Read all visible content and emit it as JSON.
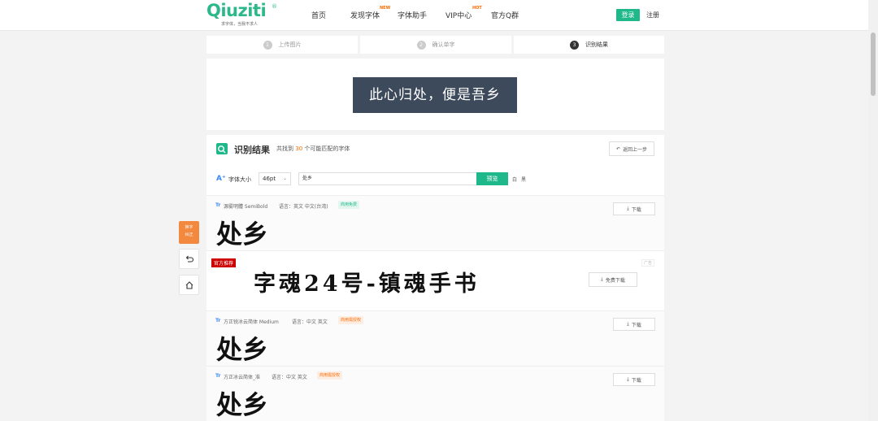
{
  "header": {
    "logo": "Qiuziti",
    "logo_reg": "®",
    "slogan": "求字体，当我不求人",
    "nav": [
      {
        "label": "首页",
        "badge": ""
      },
      {
        "label": "发现字体",
        "badge": "NEW"
      },
      {
        "label": "字体助手",
        "badge": ""
      },
      {
        "label": "VIP中心",
        "badge": "HOT"
      },
      {
        "label": "官方Q群",
        "badge": ""
      }
    ],
    "login": "登录",
    "register": "注册"
  },
  "steps": [
    {
      "num": "1",
      "label": "上传图片"
    },
    {
      "num": "2",
      "label": "确认单字"
    },
    {
      "num": "3",
      "label": "识别结果"
    }
  ],
  "preview_image_text": "此心归处，便是吾乡",
  "results": {
    "title": "识别结果",
    "count_prefix": "共找到",
    "count": "30",
    "count_suffix": "个可能匹配的字体",
    "back": "返回上一步",
    "font_size_label": "字体大小",
    "font_size_value": "46pt",
    "preview_text": "处乡",
    "preview_button": "预览",
    "bg_options": [
      "白",
      "黑"
    ]
  },
  "fonts": [
    {
      "name": "源雾明體 SemiBold",
      "lang": "语言：英文 中文(台湾)",
      "tag": "商用免费",
      "download": "下载",
      "sample": "处乡"
    },
    {
      "name": "方正锐冰云简体 Medium",
      "lang": "语言：中文 英文",
      "tag": "商用需授权",
      "download": "下载",
      "sample": "处乡"
    },
    {
      "name": "方正冰云简体_准",
      "lang": "语言：中文 英文",
      "tag": "商用需授权",
      "download": "下载",
      "sample": "处乡"
    }
  ],
  "ad": {
    "badge": "官方推荐",
    "art_text": "字魂24号-镇魂手书",
    "download": "免费下载",
    "tiny": "广告"
  },
  "side": {
    "orange_line1": "换字",
    "orange_line2": "纠正"
  },
  "colors": {
    "accent": "#1fb88b",
    "highlight": "#ff6a00",
    "ad_badge": "#cc0000"
  }
}
